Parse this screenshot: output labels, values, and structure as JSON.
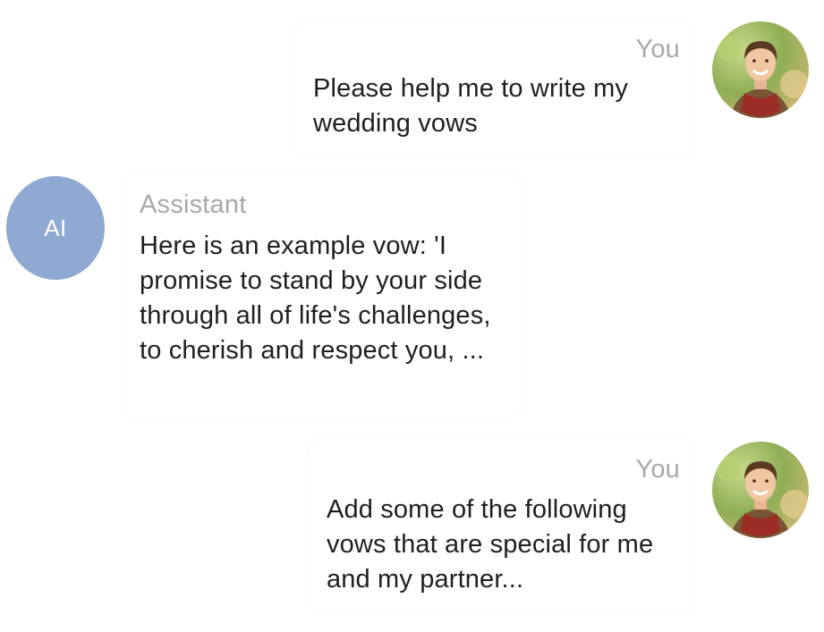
{
  "colors": {
    "ai_avatar_bg": "#8fa9d2",
    "sender_label": "#a9a9a9",
    "message_text": "#1f1f1f"
  },
  "messages": [
    {
      "role": "user",
      "sender": "You",
      "text": "Please help me to write my wedding vows",
      "avatar_icon": "user-photo-avatar"
    },
    {
      "role": "assistant",
      "sender": "Assistant",
      "text": "Here is an example vow: 'I promise to stand by your side through all of life's challenges, to cherish and respect you, ...",
      "avatar_label": "AI"
    },
    {
      "role": "user",
      "sender": "You",
      "text": "Add some of the following vows that are special for me and my partner...",
      "avatar_icon": "user-photo-avatar"
    }
  ]
}
